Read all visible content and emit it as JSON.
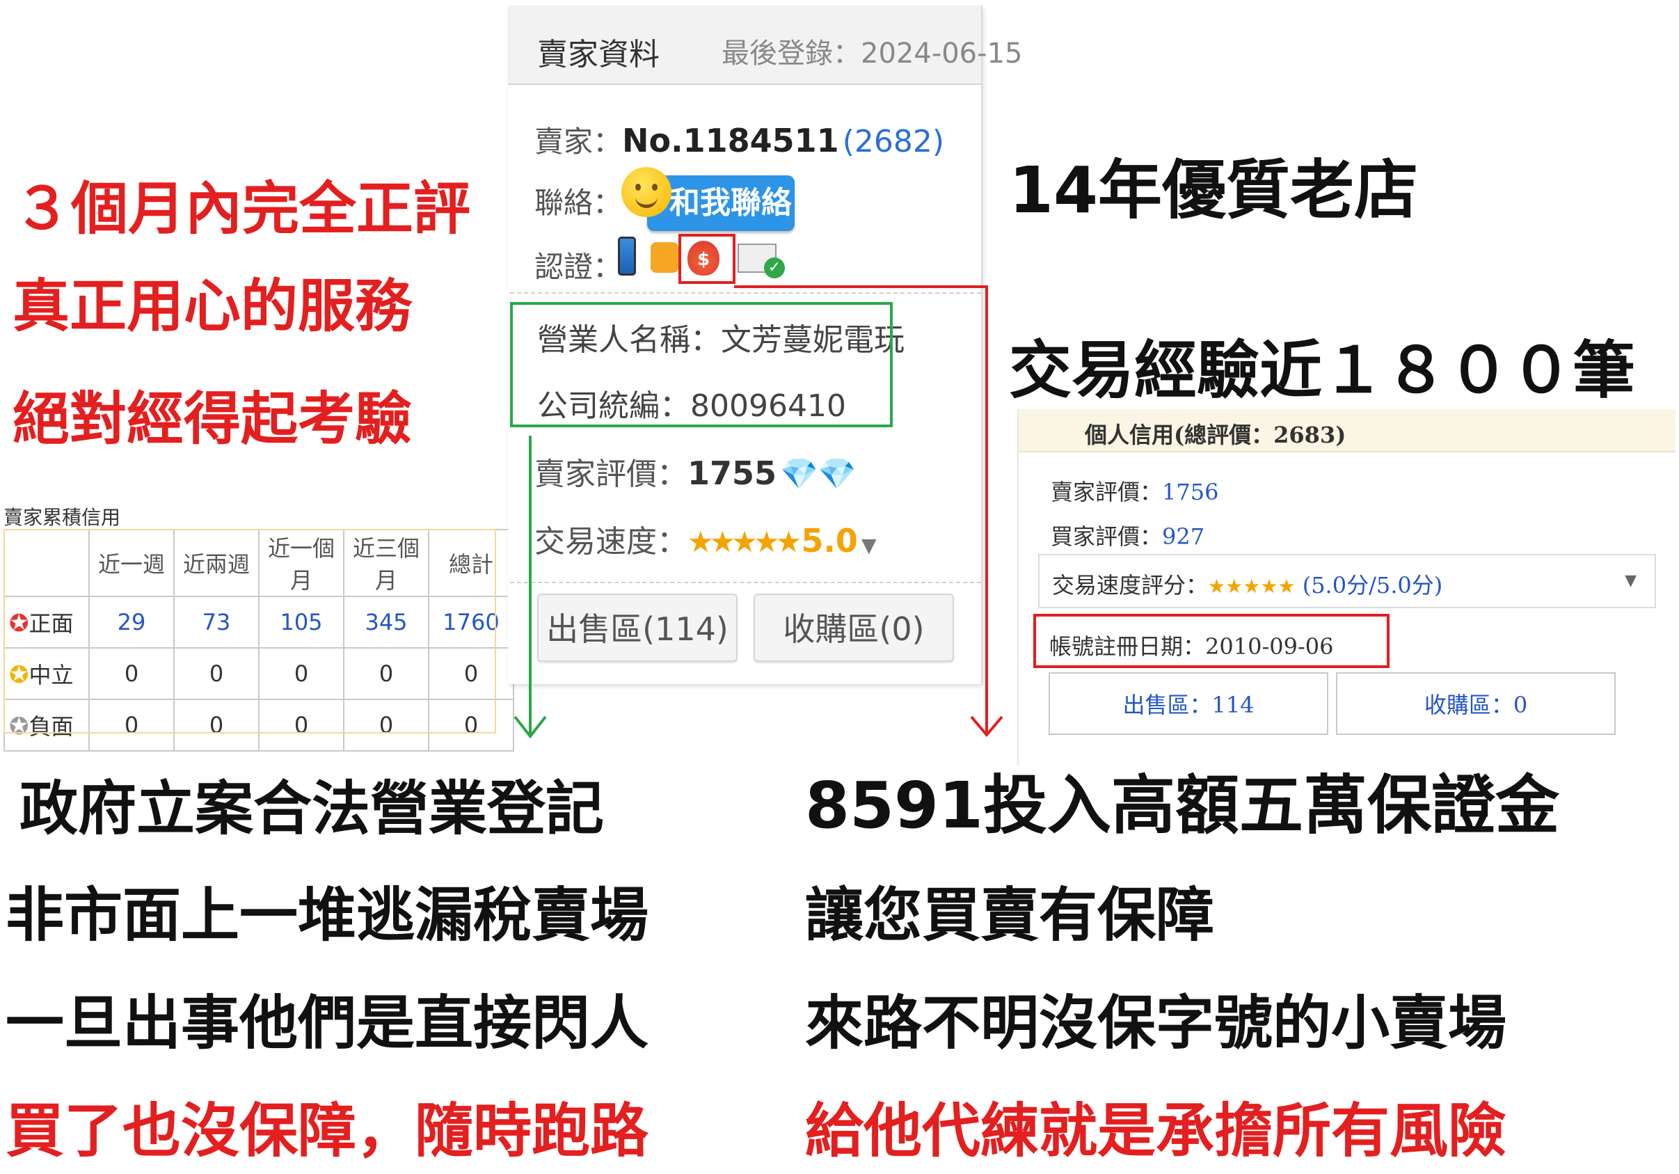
{
  "left_headline": {
    "line1": "３個月內完全正評",
    "line2": "真正用心的服務",
    "line3": "絕對經得起考驗"
  },
  "credit_table": {
    "title": "賣家累積信用",
    "headers": [
      "近一週",
      "近兩週",
      "近一個月",
      "近三個月",
      "總計"
    ],
    "rows": [
      {
        "label": "正面",
        "icon": "red-star-badge-icon",
        "values": [
          "29",
          "73",
          "105",
          "345",
          "1760"
        ]
      },
      {
        "label": "中立",
        "icon": "yellow-star-badge-icon",
        "values": [
          "0",
          "0",
          "0",
          "0",
          "0"
        ]
      },
      {
        "label": "負面",
        "icon": "gray-star-badge-icon",
        "values": [
          "0",
          "0",
          "0",
          "0",
          "0"
        ]
      }
    ]
  },
  "seller_panel": {
    "title": "賣家資料",
    "last_login": "最後登錄：2024-06-15",
    "seller_label": "賣家：",
    "seller_no": "No.1184511",
    "seller_count": "(2682)",
    "contact_label": "聯絡：",
    "contact_button": "和我聯絡",
    "verify_label": "認證：",
    "verify_icons": [
      "phone-icon",
      "telephone-icon",
      "money-bag-icon",
      "id-card-check-icon"
    ],
    "business_name": "營業人名稱：文芳蔓妮電玩",
    "company_id": "公司統編：80096410",
    "rating_label": "賣家評價：",
    "rating_value": "1755",
    "speed_label": "交易速度：",
    "speed_stars": "★★★★★",
    "speed_value": "5.0",
    "sell_tab": "出售區(114)",
    "buy_tab": "收購區(0)"
  },
  "right_headline": {
    "line1": "14年優質老店",
    "line2": "交易經驗近１８００筆"
  },
  "personal_credit": {
    "title": "個人信用(總評價：2683)",
    "seller_rating_label": "賣家評價：",
    "seller_rating": "1756",
    "buyer_rating_label": "買家評價：",
    "buyer_rating": "927",
    "speed_label": "交易速度評分：",
    "speed_stars": "★★★★★",
    "speed_score": "(5.0分/5.0分)",
    "reg_date": "帳號註冊日期：2010-09-06",
    "sell_btn": "出售區：114",
    "buy_btn": "收購區：0"
  },
  "bottom_left": {
    "line1": "政府立案合法營業登記",
    "line2": "非市面上一堆逃漏稅賣場",
    "line3": "一旦出事他們是直接閃人",
    "line4": "買了也沒保障，隨時跑路"
  },
  "bottom_right": {
    "line1": "8591投入高額五萬保證金",
    "line2": "讓您買賣有保障",
    "line3": "來路不明沒保字號的小賣場",
    "line4": "給他代練就是承擔所有風險"
  },
  "colors": {
    "red_text": "#e41f1f",
    "annotation_green": "#2aa84a",
    "annotation_red": "#e02020",
    "link_blue": "#2356c9",
    "contact_blue": "#2d94e6"
  }
}
